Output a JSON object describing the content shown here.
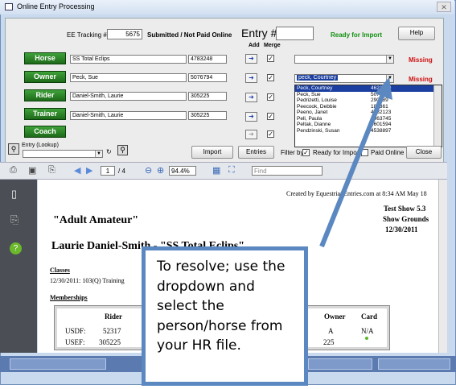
{
  "window": {
    "title": "Online Entry Processing"
  },
  "header": {
    "ee_tracking_label": "EE Tracking #",
    "ee_tracking_value": "5675",
    "status_text": "Submitted / Not Paid Online",
    "entry_label": "Entry #",
    "ready_text": "Ready for Import",
    "help_label": "Help",
    "add_label": "Add",
    "merge_label": "Merge"
  },
  "rows": [
    {
      "button": "Horse",
      "name": "SS Total Eclips",
      "number": "4783248",
      "dd_value": "",
      "status": "Missing"
    },
    {
      "button": "Owner",
      "name": "Peck, Sue",
      "number": "5076794",
      "dd_value": "peck, Courtney",
      "status": "Missing"
    },
    {
      "button": "Rider",
      "name": "Daniel-Smith, Laurie",
      "number": "305225",
      "dd_value": "",
      "status": ""
    },
    {
      "button": "Trainer",
      "name": "Daniel-Smith, Laurie",
      "number": "305225",
      "dd_value": "",
      "status": ""
    },
    {
      "button": "Coach",
      "name": "",
      "number": "",
      "dd_value": "",
      "status": ""
    }
  ],
  "dropdown_items": [
    {
      "name": "Peck, Courtney",
      "number": "4621539"
    },
    {
      "name": "Peck, Sue",
      "number": "5076794"
    },
    {
      "name": "Pedrizetti, Louise",
      "number": "290289"
    },
    {
      "name": "Peecook, Debbie",
      "number": "184361"
    },
    {
      "name": "Peeno, Janet",
      "number": "4082123"
    },
    {
      "name": "Pell, Paula",
      "number": "4063745"
    },
    {
      "name": "Peltak, Dianne",
      "number": "4601594"
    },
    {
      "name": "Pendzinski, Susan",
      "number": "4538897"
    }
  ],
  "bottom_bar": {
    "lookup_label": "Entry (Lookup)",
    "import_label": "Import",
    "entries_label": "Entries",
    "filter_label": "Filter by",
    "ready_import_label": "Ready for Import",
    "paid_online_label": "Paid Online",
    "close_label": "Close"
  },
  "pdf_toolbar": {
    "page_current": "1",
    "page_total": "/ 4",
    "zoom": "94.4%",
    "find_placeholder": "Find"
  },
  "document": {
    "created_by": "Created by EquestrianEntries.com at 8:34 AM May 18",
    "show_name": "Test Show 5.3",
    "location": "Show Grounds",
    "date": "12/30/2011",
    "division": "\"Adult Amateur\"",
    "rider_line": "Laurie Daniel-Smith - \"SS Total Eclips\"",
    "classes_heading": "Classes",
    "class_line": "12/30/2011: 103(Q) Training",
    "memberships_heading": "Memberships",
    "table_headers": [
      "",
      "Rider",
      "Owner",
      "Card"
    ],
    "table_rows": [
      [
        "USDF:",
        "52317",
        "A",
        "N/A"
      ],
      [
        "USEF:",
        "305225",
        "225",
        ""
      ]
    ]
  },
  "callout": {
    "text": "To resolve; use the dropdown and select the person/horse from your HR file."
  },
  "colors": {
    "accent_green": "#2a8a26",
    "missing_red": "#d01010",
    "callout_border": "#5b88c1",
    "selection_blue": "#1b3fa0"
  }
}
